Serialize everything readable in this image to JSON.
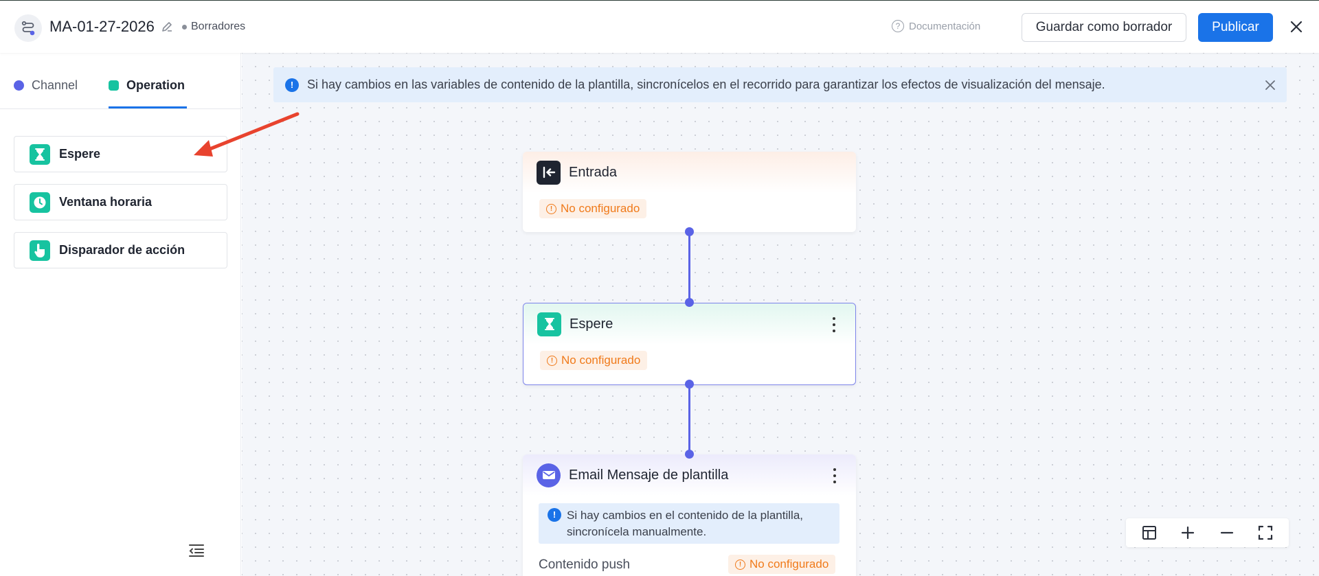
{
  "header": {
    "title": "MA-01-27-2026",
    "status": "Borradores",
    "docs_label": "Documentación",
    "save_draft_label": "Guardar como borrador",
    "publish_label": "Publicar"
  },
  "sidebar": {
    "tabs": [
      {
        "label": "Channel",
        "color": "#5a63e6",
        "active": false
      },
      {
        "label": "Operation",
        "color": "#17c3a0",
        "active": true
      }
    ],
    "operations": [
      {
        "label": "Espere",
        "icon": "hourglass-icon"
      },
      {
        "label": "Ventana horaria",
        "icon": "clock-icon"
      },
      {
        "label": "Disparador de acción",
        "icon": "hand-pointer-icon"
      }
    ]
  },
  "banner": {
    "text": "Si hay cambios en las variables de contenido de la plantilla, sincronícelos en el recorrido para garantizar los efectos de visualización del mensaje."
  },
  "nodes": {
    "entry": {
      "title": "Entrada",
      "status": "No configurado"
    },
    "wait": {
      "title": "Espere",
      "status": "No configurado"
    },
    "email": {
      "title": "Email Mensaje de plantilla",
      "note": "Si hay cambios en el contenido de la plantilla, sincronícela manualmente.",
      "push_label": "Contenido push",
      "status": "No configurado"
    }
  },
  "colors": {
    "primary": "#1a73e8",
    "operation": "#17c3a0",
    "channel": "#5a63e6",
    "warning": "#f07a1a",
    "annotation_arrow": "#e8432e"
  }
}
